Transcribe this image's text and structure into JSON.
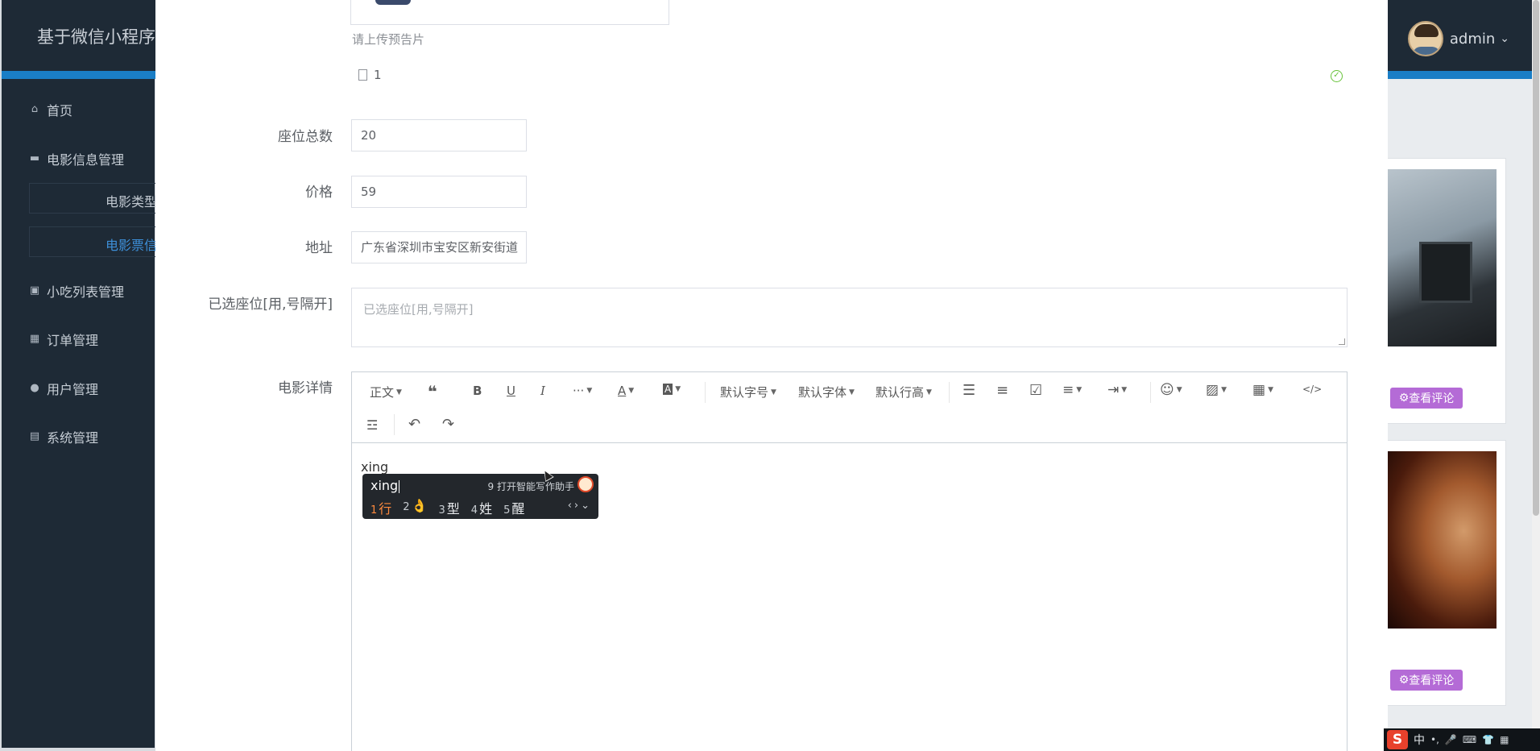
{
  "app": {
    "brand": "基于微信小程序",
    "user": {
      "name": "admin"
    }
  },
  "sidebar": {
    "items": [
      {
        "icon": "home-icon",
        "label": "首页"
      },
      {
        "icon": "folder-icon",
        "label": "电影信息管理"
      },
      {
        "icon": "sub",
        "label": "电影类型"
      },
      {
        "icon": "sub",
        "label": "电影票信"
      },
      {
        "icon": "bag-icon",
        "label": "小吃列表管理"
      },
      {
        "icon": "grid-icon",
        "label": "订单管理"
      },
      {
        "icon": "user-icon",
        "label": "用户管理"
      },
      {
        "icon": "settings-icon",
        "label": "系统管理"
      }
    ]
  },
  "cards": {
    "comment_label": "查看评论"
  },
  "form": {
    "upload_hint": "请上传预告片",
    "uploaded_file": "1",
    "seats_label": "座位总数",
    "seats_value": "20",
    "price_label": "价格",
    "price_value": "59",
    "address_label": "地址",
    "address_value": "广东省深圳市宝安区新安街道",
    "selected_seats_label": "已选座位[用,号隔开]",
    "selected_seats_placeholder": "已选座位[用,号隔开]",
    "details_label": "电影详情"
  },
  "editor": {
    "toolbar": {
      "paragraph": "正文",
      "font_size": "默认字号",
      "font_family": "默认字体",
      "line_height": "默认行高"
    },
    "content": "xing"
  },
  "ime": {
    "input": "xing",
    "assist": "9 打开智能写作助手",
    "candidates": [
      {
        "num": "1",
        "text": "行"
      },
      {
        "num": "2",
        "text": "👌"
      },
      {
        "num": "3",
        "text": "型"
      },
      {
        "num": "4",
        "text": "姓"
      },
      {
        "num": "5",
        "text": "醒"
      }
    ]
  },
  "tray": {
    "logo": "S",
    "mode": "中"
  }
}
